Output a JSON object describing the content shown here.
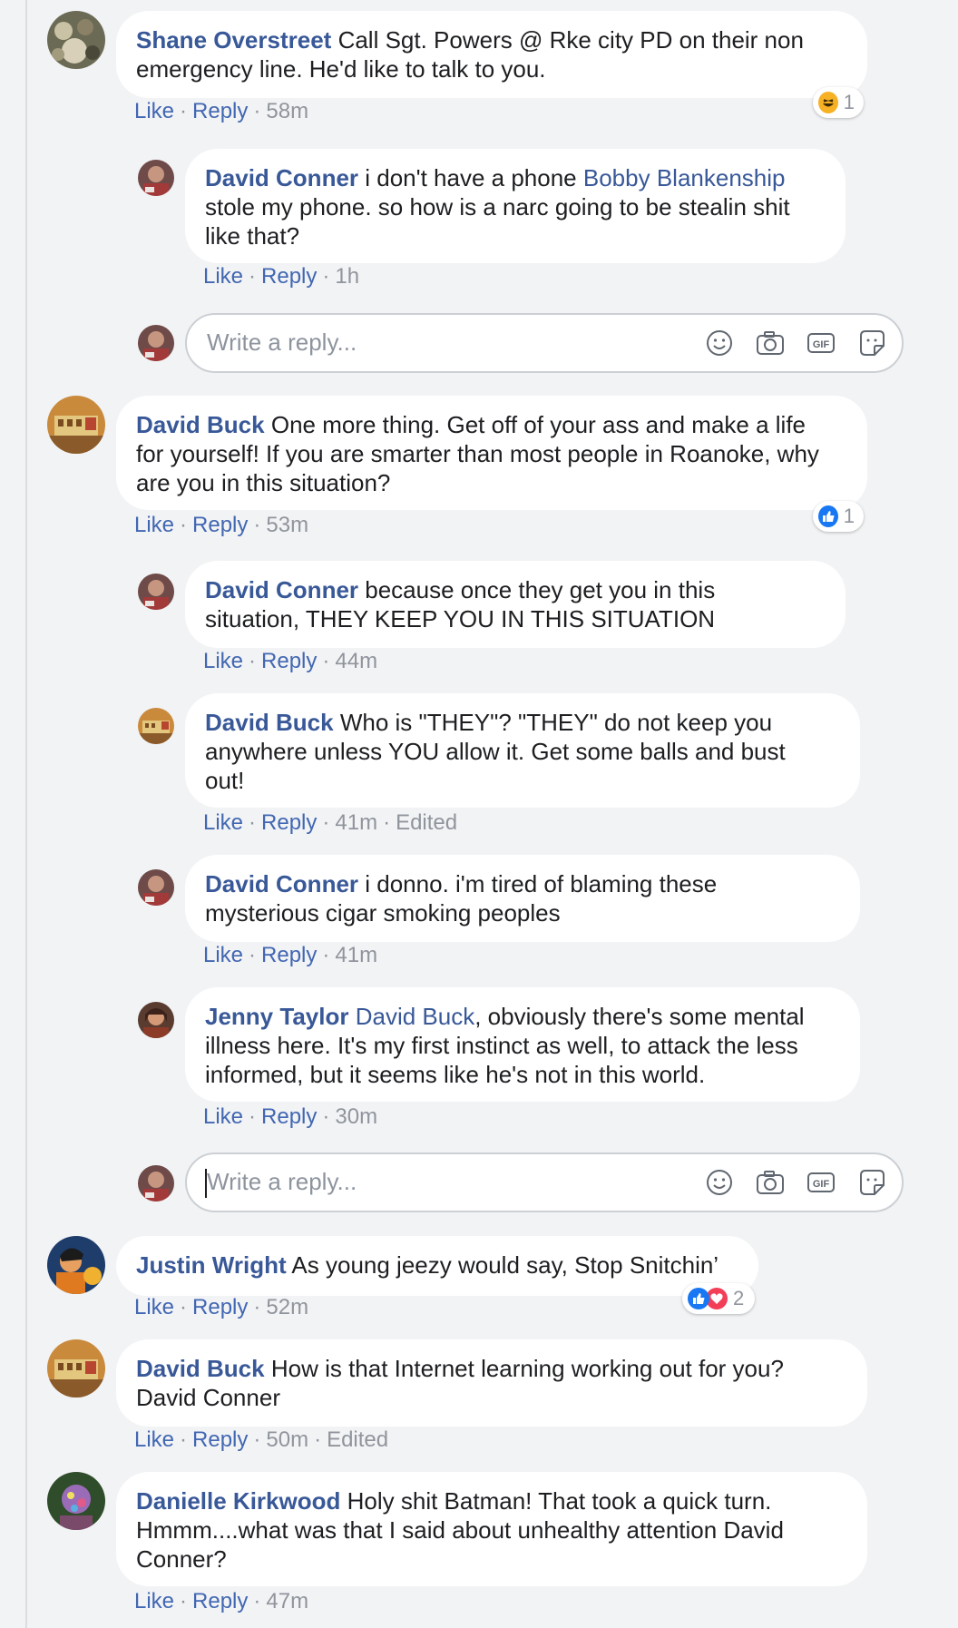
{
  "colors": {
    "background": "#f2f3f5",
    "bubble": "#ffffff",
    "author": "#385898",
    "action": "#4267b2",
    "meta": "#90949c",
    "like_blue": "#1877f2",
    "love_red": "#f33e58",
    "haha_yellow": "#f7b125"
  },
  "reply_placeholder": "Write a reply...",
  "actions": {
    "like": "Like",
    "reply": "Reply",
    "edited": "Edited"
  },
  "comments": {
    "c1": {
      "author": "Shane Overstreet",
      "line1": "Call Sgt. Powers @ Rke city PD on their non",
      "line2": "emergency line. He'd like to talk to you.",
      "time": "58m",
      "reaction": {
        "type": "haha",
        "count": "1"
      }
    },
    "r1": {
      "author": "David Conner",
      "line1a": "i don't have a phone ",
      "mention": "Bobby Blankenship",
      "line2": "stole my phone. so how is a narc going to be stealin shit",
      "line3": "like that?",
      "time": "1h"
    },
    "c2": {
      "author": "David Buck",
      "line1": "One more thing. Get off of your ass and make a life",
      "line2": "for yourself! If you are smarter than most people in Roanoke, why",
      "line3": "are you in this situation?",
      "time": "53m",
      "reaction": {
        "type": "like",
        "count": "1"
      }
    },
    "r2": {
      "author": "David Conner",
      "line1": "because once they get you in this",
      "line2": "situation, THEY KEEP YOU IN THIS SITUATION",
      "time": "44m"
    },
    "r3": {
      "author": "David Buck",
      "line1": "Who is \"THEY\"? \"THEY\" do not keep you",
      "line2": "anywhere unless YOU allow it. Get some balls and bust",
      "line3": "out!",
      "time": "41m"
    },
    "r4": {
      "author": "David Conner",
      "line1": "i donno. i'm tired of blaming these",
      "line2": "mysterious cigar smoking peoples",
      "time": "41m"
    },
    "r5": {
      "author": "Jenny Taylor",
      "mention": "David Buck",
      "line1": ", obviously there's some mental",
      "line2": "illness here. It's my first instinct as well, to attack the less",
      "line3": "informed, but it seems like he's not in this world.",
      "time": "30m"
    },
    "c3": {
      "author": "Justin Wright",
      "line1": "As young jeezy would say, Stop Snitchin’",
      "time": "52m",
      "reaction": {
        "type": "like+love",
        "count": "2"
      }
    },
    "c4": {
      "author": "David Buck",
      "line1": "How is that Internet learning working out for you?",
      "line2": "David Conner",
      "time": "50m"
    },
    "c5": {
      "author": "Danielle Kirkwood",
      "line1": "Holy shit Batman! That took a quick turn.",
      "line2": "Hmmm....what was that I said about unhealthy attention David",
      "line3": "Conner?",
      "time": "47m"
    }
  },
  "icons": [
    "emoji-icon",
    "camera-icon",
    "gif-icon",
    "sticker-icon"
  ]
}
